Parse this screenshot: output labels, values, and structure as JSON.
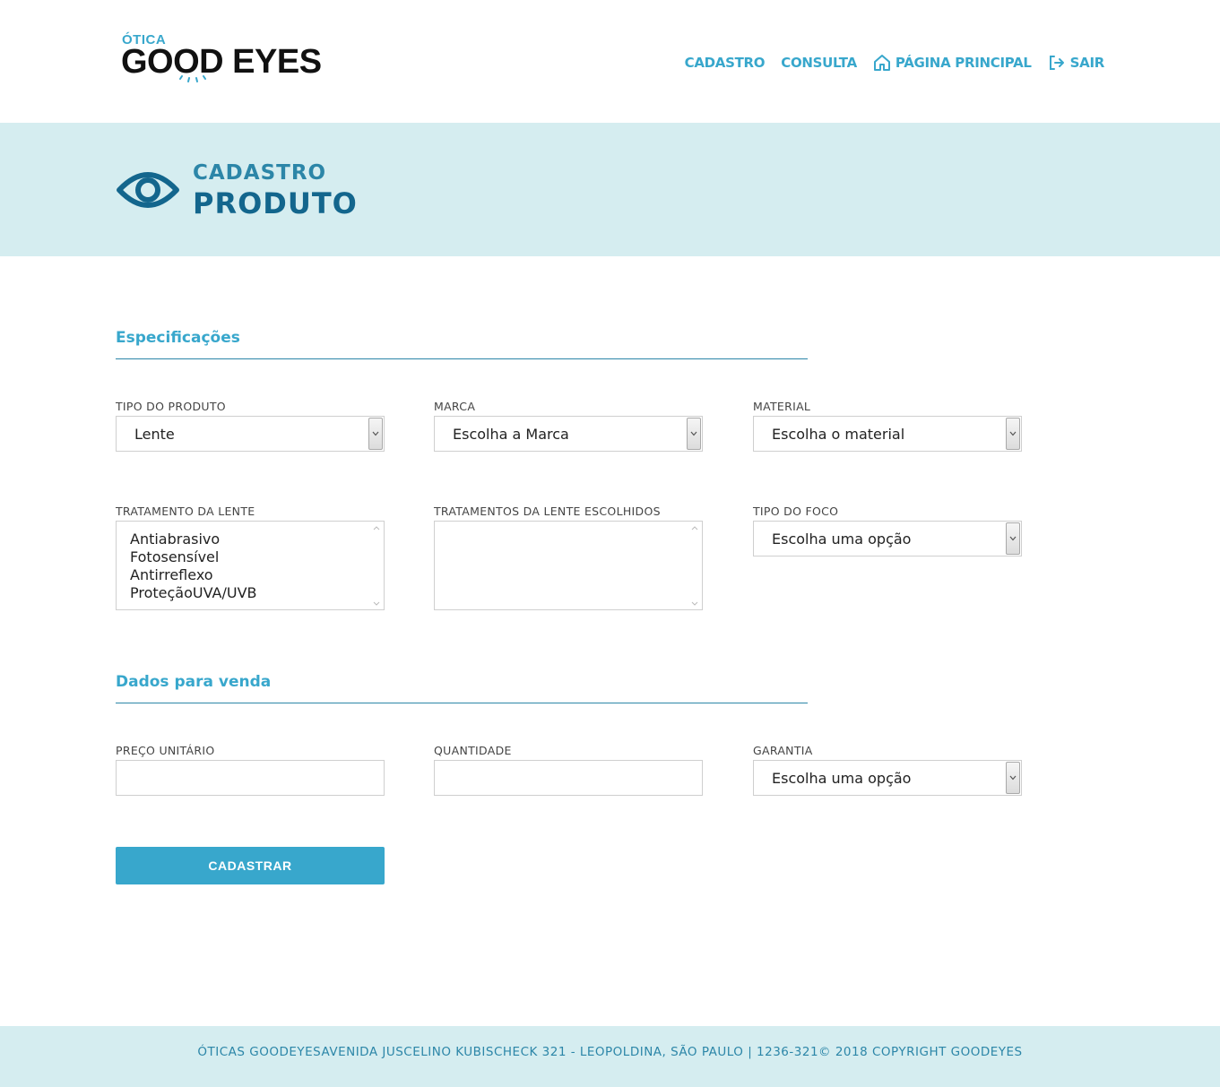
{
  "header": {
    "logo_top": "ÓTICA",
    "logo_main": "GOOD EYES",
    "nav": {
      "cadastro": "CADASTRO",
      "consulta": "CONSULTA",
      "home": "PÁGINA PRINCIPAL",
      "logout": "SAIR"
    }
  },
  "banner": {
    "subtitle": "CADASTRO",
    "title": "PRODUTO"
  },
  "sections": {
    "specs_title": "Especificações",
    "sale_title": "Dados para venda"
  },
  "fields": {
    "tipo_produto": {
      "label": "TIPO DO PRODUTO",
      "value": "Lente"
    },
    "marca": {
      "label": "MARCA",
      "value": "Escolha a Marca"
    },
    "material": {
      "label": "MATERIAL",
      "value": "Escolha o material"
    },
    "tratamento": {
      "label": "TRATAMENTO DA LENTE",
      "options": [
        "Antiabrasivo",
        "Fotosensível",
        "Antirreflexo",
        "ProteçãoUVA/UVB"
      ]
    },
    "tratamentos_escolhidos": {
      "label": "TRATAMENTOS DA LENTE ESCOLHIDOS"
    },
    "tipo_foco": {
      "label": "TIPO DO FOCO",
      "value": "Escolha uma opção"
    },
    "preco": {
      "label": "PREÇO UNITÁRIO",
      "value": ""
    },
    "quantidade": {
      "label": "QUANTIDADE",
      "value": ""
    },
    "garantia": {
      "label": "GARANTIA",
      "value": "Escolha uma opção"
    }
  },
  "submit_label": "CADASTRAR",
  "footer_text": "ÓTICAS GOODEYESAVENIDA JUSCELINO KUBISCHECK 321 - LEOPOLDINA, SÃO PAULO | 1236-321© 2018 COPYRIGHT GOODEYES",
  "colors": {
    "accent": "#38a7cc",
    "accent_dark": "#13668d",
    "banner_bg": "#d5edf0"
  }
}
